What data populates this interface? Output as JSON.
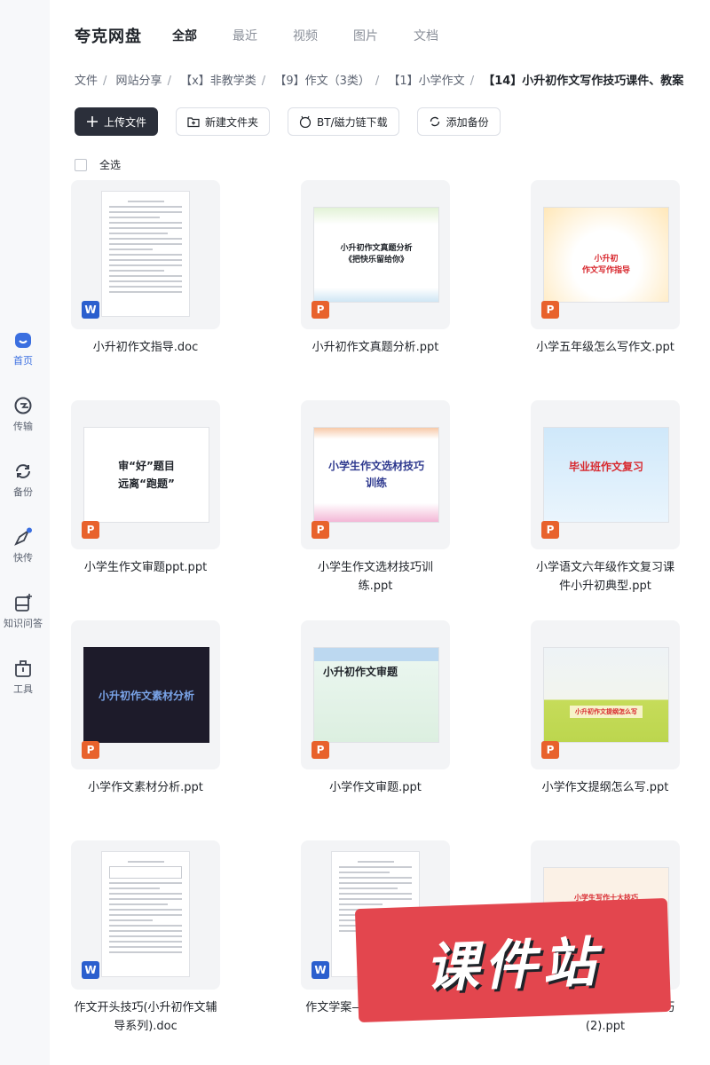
{
  "sidebar": {
    "items": [
      {
        "label": "首页",
        "icon": "home-icon",
        "active": true
      },
      {
        "label": "传输",
        "icon": "transfer-icon"
      },
      {
        "label": "备份",
        "icon": "backup-icon"
      },
      {
        "label": "快传",
        "icon": "quick-send-icon"
      },
      {
        "label": "知识问答",
        "icon": "qa-icon"
      },
      {
        "label": "工具",
        "icon": "toolbox-icon"
      }
    ]
  },
  "header": {
    "brand": "夸克网盘",
    "tabs": [
      "全部",
      "最近",
      "视频",
      "图片",
      "文档"
    ],
    "active_tab": "全部"
  },
  "breadcrumb": [
    "文件",
    "网站分享",
    "【x】非教学类",
    "【9】作文（3类）",
    "【1】小学作文",
    "【14】小升初作文写作技巧课件、教案"
  ],
  "toolbar": {
    "upload": "上传文件",
    "new_folder": "新建文件夹",
    "bt": "BT/磁力链下载",
    "backup": "添加备份"
  },
  "select_all": "全选",
  "files": [
    {
      "name": "小升初作文指导.doc",
      "type": "W",
      "kind": "doc"
    },
    {
      "name": "小升初作文真题分析.ppt",
      "type": "P",
      "kind": "slide",
      "slide_title": "小升初作文真题分析\n《把快乐留给你》"
    },
    {
      "name": "小学五年级怎么写作文.ppt",
      "type": "P",
      "kind": "slide",
      "slide_title": "小升初\n作文写作指导"
    },
    {
      "name": "小学生作文审题ppt.ppt",
      "type": "P",
      "kind": "slide",
      "slide_title": "审“好”题目\n远离“跑题”"
    },
    {
      "name": "小学生作文选材技巧训练.ppt",
      "type": "P",
      "kind": "slide",
      "slide_title": "小学生作文选材技巧\n训练"
    },
    {
      "name": "小学语文六年级作文复习课件小升初典型.ppt",
      "type": "P",
      "kind": "slide",
      "slide_title": "毕业班作文复习"
    },
    {
      "name": "小学作文素材分析.ppt",
      "type": "P",
      "kind": "slide",
      "slide_title": "小升初作文素材分析"
    },
    {
      "name": "小学作文审题.ppt",
      "type": "P",
      "kind": "slide",
      "slide_title": "小升初作文审题"
    },
    {
      "name": "小学作文提纲怎么写.ppt",
      "type": "P",
      "kind": "slide",
      "slide_title": "小升初作文提纲怎么写"
    },
    {
      "name": "作文开头技巧(小升初作文辅导系列).doc",
      "type": "W",
      "kind": "doc"
    },
    {
      "name": "作文学案——审题方法.doc",
      "type": "W",
      "kind": "doc"
    },
    {
      "name": "最新小学生写作的十大技巧(2).ppt",
      "type": "P",
      "kind": "slide",
      "slide_title": "小学生写作十大技巧"
    }
  ],
  "watermark": "课件站"
}
